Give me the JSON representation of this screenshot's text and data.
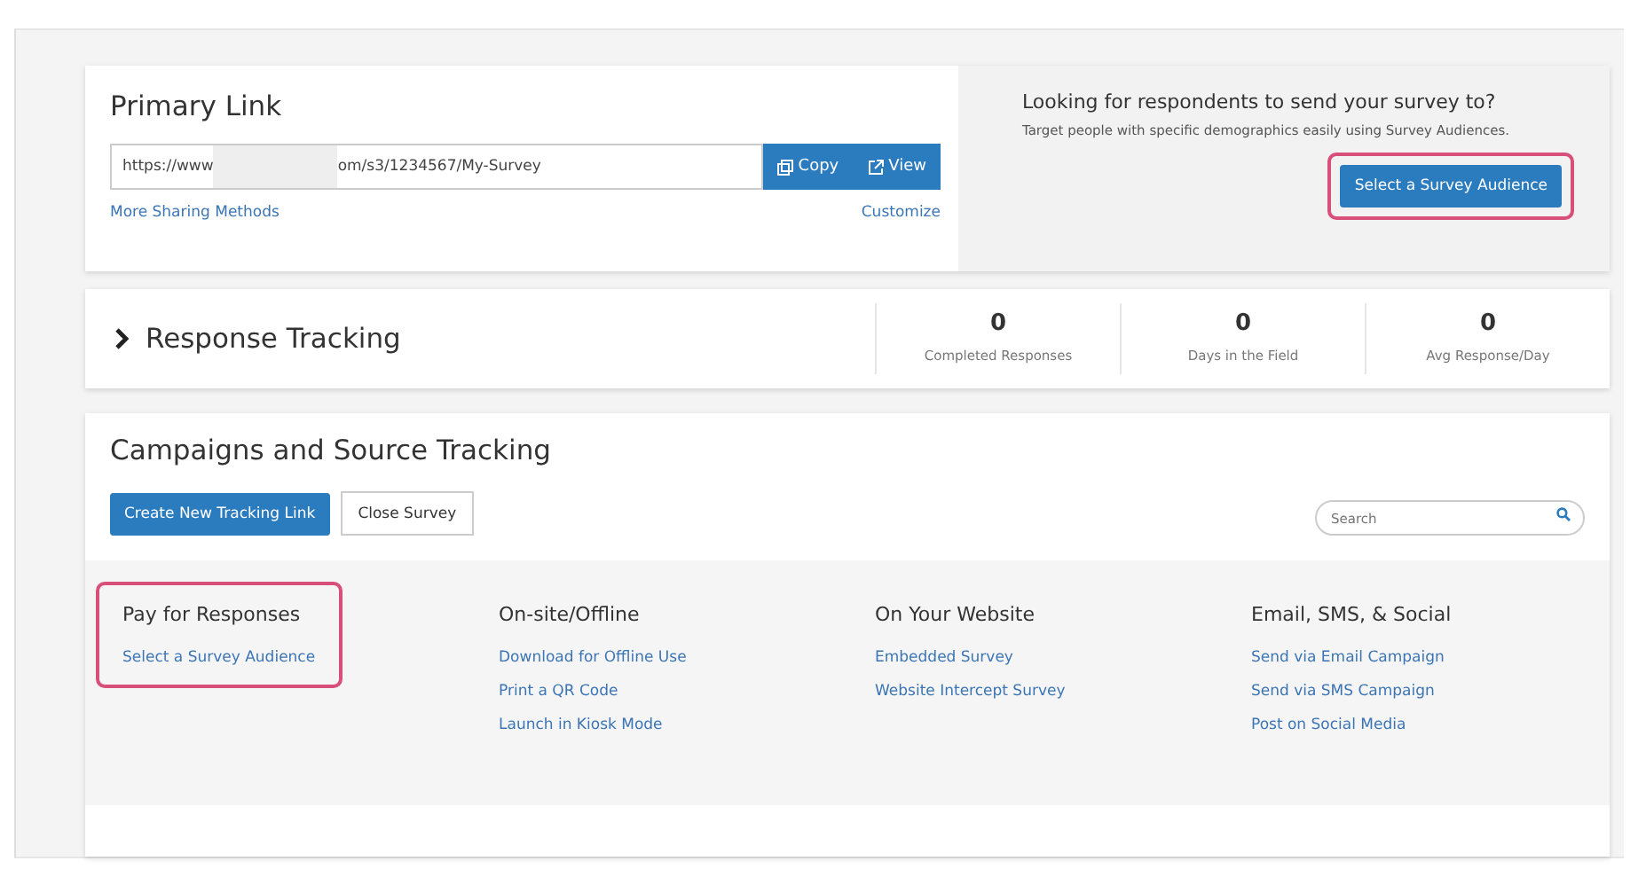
{
  "primary_link": {
    "title": "Primary Link",
    "url_start": "https://www",
    "url_end": "om/s3/1234567/My-Survey",
    "redacted": true,
    "buttons": [
      {
        "kind": "copy",
        "label": "Copy"
      },
      {
        "kind": "view",
        "label": "View"
      }
    ],
    "more_link": "More Sharing Methods",
    "customize_link": "Customize"
  },
  "audience_panel": {
    "title": "Looking for respondents to send your survey to?",
    "text": "Target people with specific demographics easily using Survey Audiences.",
    "button": "Select a Survey Audience",
    "highlighted": true
  },
  "response_tracking": {
    "title": "Response Tracking",
    "expanded": false,
    "stats": [
      {
        "value": "0",
        "label": "Completed Responses"
      },
      {
        "value": "0",
        "label": "Days in the Field"
      },
      {
        "value": "0",
        "label": "Avg Response/Day"
      }
    ]
  },
  "campaigns": {
    "title": "Campaigns and Source Tracking",
    "buttons": [
      {
        "kind": "primary",
        "label": "Create New Tracking Link"
      },
      {
        "kind": "secondary",
        "label": "Close Survey"
      }
    ],
    "search": {
      "placeholder": "Search"
    },
    "columns": [
      {
        "title": "Pay for Responses",
        "highlighted": true,
        "links": [
          "Select a Survey Audience"
        ]
      },
      {
        "title": "On-site/Offline",
        "highlighted": false,
        "links": [
          "Download for Offline Use",
          "Print a QR Code",
          "Launch in Kiosk Mode"
        ]
      },
      {
        "title": "On Your Website",
        "highlighted": false,
        "links": [
          "Embedded Survey",
          "Website Intercept Survey"
        ]
      },
      {
        "title": "Email, SMS, & Social",
        "highlighted": false,
        "links": [
          "Send via Email Campaign",
          "Send via SMS Campaign",
          "Post on Social Media"
        ]
      }
    ]
  }
}
